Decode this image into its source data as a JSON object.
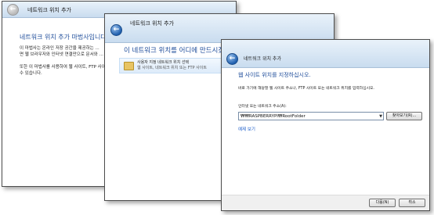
{
  "window1": {
    "title": "네트워크 위치 추가",
    "heading": "네트워크 위치 추가 마법사입니다",
    "paragraph1_line1": "이 마법사는 온라인 저장 공간을 제공하는 ...",
    "paragraph1_line2": "면 웹 브라우저와 인터넷 연결만으로 문서와 ...",
    "paragraph2_line1": "또한 이 마법사를 사용하여 웹 사이트, FTP 사이트 ...",
    "paragraph2_line2": "수 있습니다."
  },
  "window2": {
    "title": "네트워크 위치 추가",
    "heading": "이 네트워크 위치를 어디에 만드시겠습니까?",
    "option_title": "사용자 지정 네트워크 위치 선택",
    "option_desc": "웹 사이트, 네트워크 위치 또는 FTP 사이트"
  },
  "window3": {
    "title": "네트워크 위치 추가",
    "heading": "웹 사이트 위치를 지정하십시오.",
    "instructions": "바로 가기에 해당할 웹 사이트 주소나, FTP 사이트 또는 네트워크 위치를 입력하십시오.",
    "field_label": "인터넷 또는 네트워크 주소(A):",
    "field_value": "₩₩RASPBERRYPI₩RootFolder",
    "browse_label": "찾아보기(R)...",
    "example_link": "예제 보기",
    "next_label": "다음(N)",
    "cancel_label": "취소"
  },
  "icons": {
    "back": "←",
    "dropdown": "▼"
  }
}
